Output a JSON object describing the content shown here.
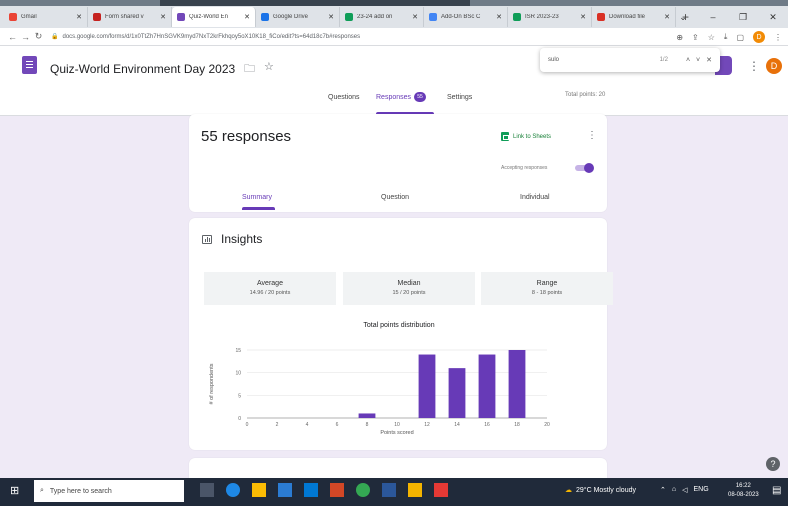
{
  "browser": {
    "tabs": [
      {
        "label": "Gmail",
        "color": "#ea4335",
        "active": false
      },
      {
        "label": "Form shared v",
        "color": "#c5221f",
        "active": false
      },
      {
        "label": "Quiz-World En",
        "color": "#7248b9",
        "active": true
      },
      {
        "label": "Google Drive",
        "color": "#1a73e8",
        "active": false
      },
      {
        "label": "23-24 add on",
        "color": "#0f9d58",
        "active": false
      },
      {
        "label": "Add-On BSc C",
        "color": "#4285f4",
        "active": false
      },
      {
        "label": "ISR 2023-23",
        "color": "#0f9d58",
        "active": false
      },
      {
        "label": "Download file",
        "color": "#d93025",
        "active": false
      }
    ],
    "url": "docs.google.com/forms/d/1x0TtZh7HnSGVK9myd7NxT2krFkhqoy5oX10K18_fiCo/edit?ts=64d18c7b#responses"
  },
  "find_bar": {
    "query": "sulo",
    "count": "1/2"
  },
  "form": {
    "title": "Quiz-World Environment Day 2023",
    "avatar_letter": "D",
    "nav": {
      "questions": "Questions",
      "responses": "Responses",
      "responses_count": "55",
      "settings": "Settings"
    },
    "total_points": "Total points: 20"
  },
  "responses_card": {
    "title": "55 responses",
    "link_to_sheets": "Link to Sheets",
    "accepting_label": "Accepting responses",
    "accepting": true,
    "tabs": [
      "Summary",
      "Question",
      "Individual"
    ],
    "active_tab": "Summary"
  },
  "insights": {
    "title": "Insights",
    "stats": [
      {
        "label": "Average",
        "value": "14.96 / 20 points"
      },
      {
        "label": "Median",
        "value": "15 / 20 points"
      },
      {
        "label": "Range",
        "value": "8 - 18 points"
      }
    ]
  },
  "chart_data": {
    "type": "bar",
    "title": "Total points distribution",
    "xlabel": "Points scored",
    "ylabel": "# of respondents",
    "x": [
      8,
      12,
      14,
      16,
      18
    ],
    "values": [
      1,
      14,
      11,
      14,
      15
    ],
    "xlim": [
      0,
      20
    ],
    "ylim": [
      0,
      15
    ],
    "xticks": [
      0,
      2,
      4,
      6,
      8,
      10,
      12,
      14,
      16,
      18,
      20
    ],
    "yticks": [
      0,
      5,
      10,
      15
    ],
    "bar_color": "#673ab7",
    "grid": true
  },
  "taskbar": {
    "search_placeholder": "Type here to search",
    "weather": "29°C  Mostly cloudy",
    "lang": "ENG",
    "time": "16:22",
    "date": "08-08-2023"
  },
  "help_glyph": "?"
}
